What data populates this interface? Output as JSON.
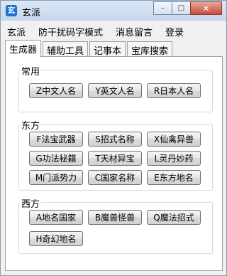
{
  "window": {
    "title": "玄派",
    "icon_glyph": "玄"
  },
  "caption": {
    "minimize": "–",
    "maximize": "□",
    "close": "✕"
  },
  "menu": [
    "玄派",
    "防干扰码字模式",
    "消息留言",
    "登录"
  ],
  "tabs": [
    "生成器",
    "辅助工具",
    "记事本",
    "宝库搜索"
  ],
  "groups": {
    "common": {
      "label": "常用",
      "buttons": [
        "Z中文人名",
        "Y英文人名",
        "R日本人名"
      ]
    },
    "east": {
      "label": "东方",
      "buttons": [
        "F法宝武器",
        "S招式名称",
        "X仙禽异兽",
        "G功法秘籍",
        "T天材异宝",
        "L灵丹妙药",
        "M门派势力",
        "C国家名称",
        "E东方地名"
      ]
    },
    "west": {
      "label": "西方",
      "buttons": [
        "A地名国家",
        "B魔兽怪兽",
        "Q魔法招式",
        "H奇幻地名"
      ]
    }
  }
}
